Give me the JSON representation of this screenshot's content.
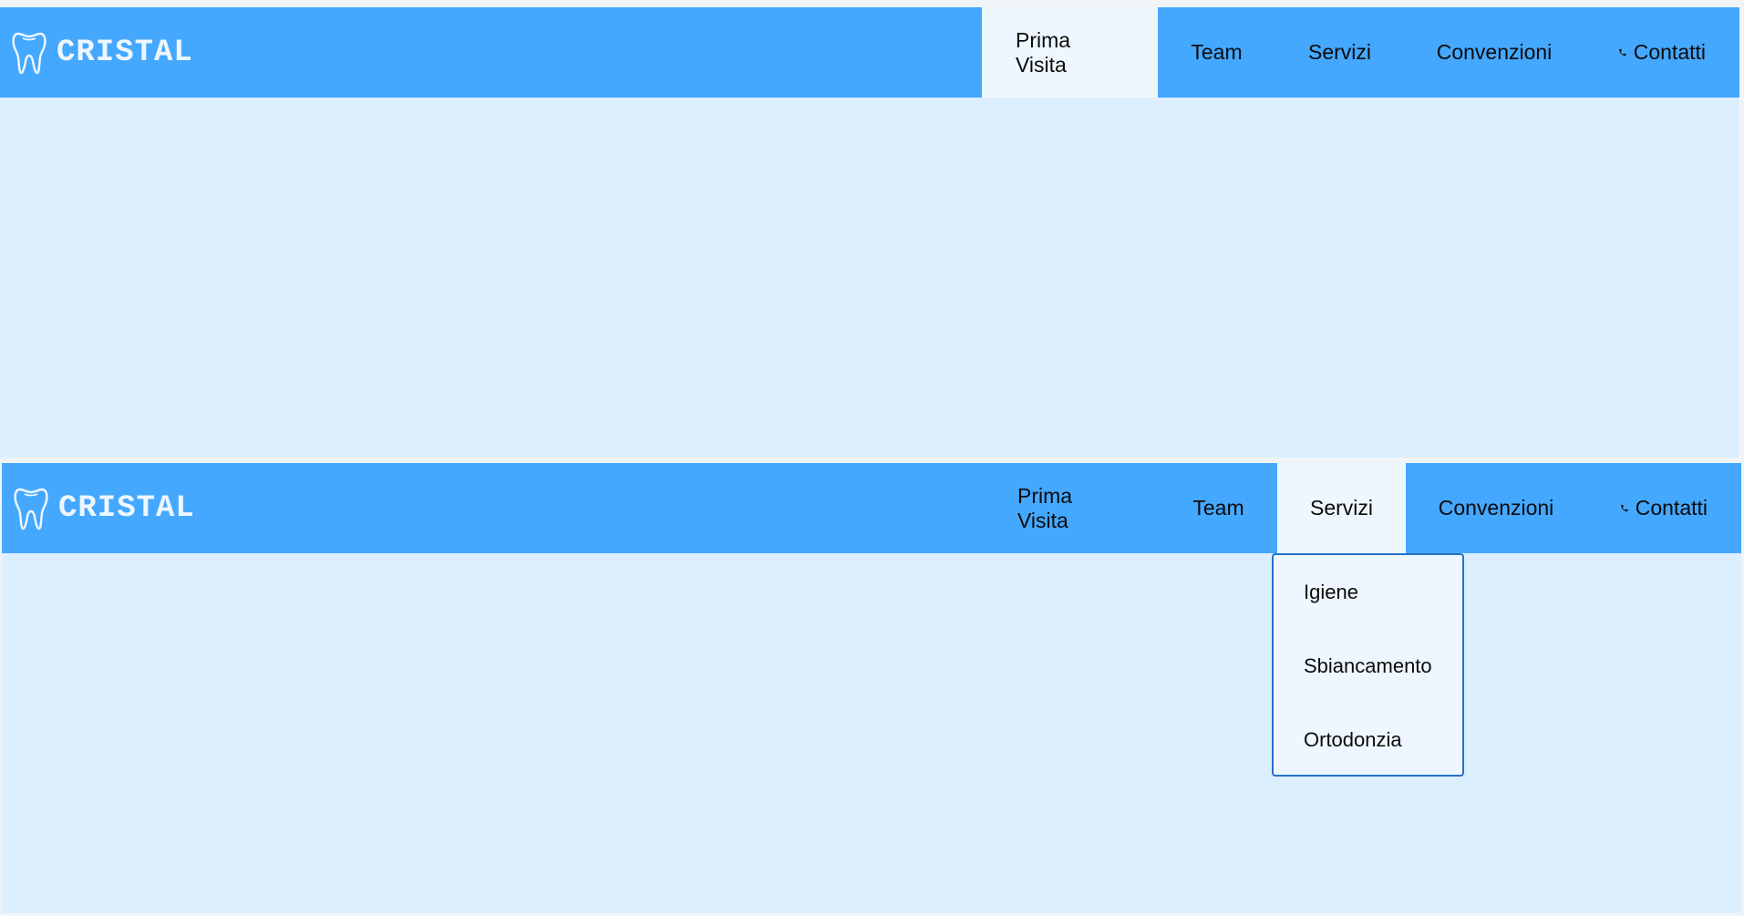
{
  "brand": {
    "name": "CRISTAL",
    "logo_icon": "tooth-icon"
  },
  "nav": {
    "items": [
      {
        "label": "Prima Visita"
      },
      {
        "label": "Team"
      },
      {
        "label": "Servizi"
      },
      {
        "label": "Convenzioni"
      },
      {
        "label": "Contatti",
        "icon": "phone-icon"
      }
    ]
  },
  "states": {
    "top": {
      "active_item": "Prima Visita"
    },
    "bottom": {
      "active_item": "Servizi",
      "dropdown_open": true
    }
  },
  "servizi_dropdown": {
    "items": [
      {
        "label": "Igiene"
      },
      {
        "label": "Sbiancamento"
      },
      {
        "label": "Ortodonzia"
      }
    ]
  },
  "colors": {
    "navbar": "#45a8ff",
    "content_bg": "#dcefff",
    "active_item_bg": "#eef7ff",
    "dropdown_border": "#2372c9"
  }
}
